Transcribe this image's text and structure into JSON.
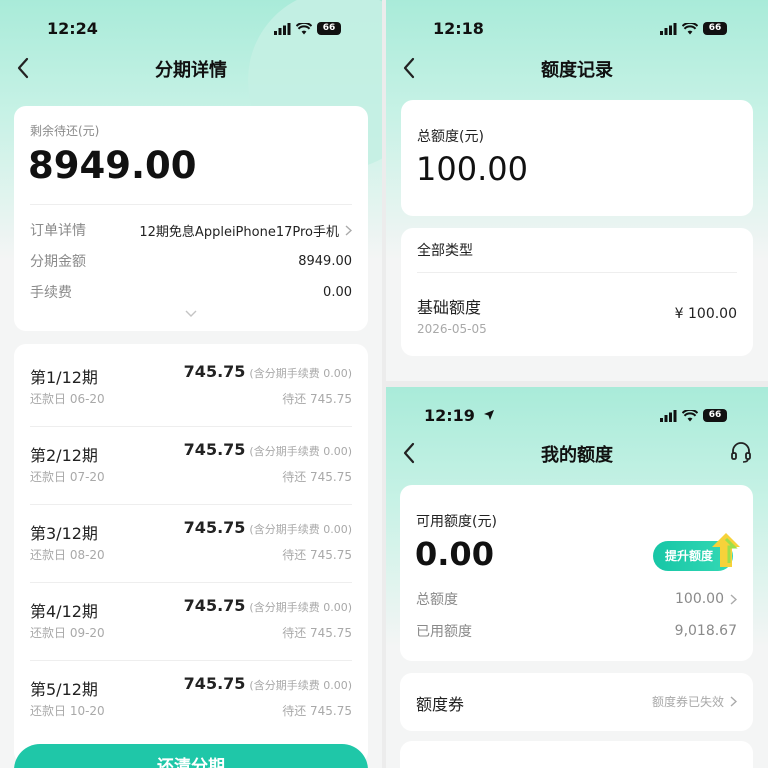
{
  "left": {
    "time": "12:24",
    "battery": "66",
    "title": "分期详情",
    "remaining_label": "剩余待还(元)",
    "remaining_amount": "8949.00",
    "order_label": "订单详情",
    "order_value": "12期免息AppleiPhone17Pro手机",
    "installment_label": "分期金额",
    "installment_value": "8949.00",
    "fee_label": "手续费",
    "fee_value": "0.00",
    "periods": [
      {
        "title": "第1/12期",
        "amount": "745.75",
        "fee_note": "(含分期手续费 0.00)",
        "due": "还款日 06-20",
        "pending": "待还 745.75"
      },
      {
        "title": "第2/12期",
        "amount": "745.75",
        "fee_note": "(含分期手续费 0.00)",
        "due": "还款日 07-20",
        "pending": "待还 745.75"
      },
      {
        "title": "第3/12期",
        "amount": "745.75",
        "fee_note": "(含分期手续费 0.00)",
        "due": "还款日 08-20",
        "pending": "待还 745.75"
      },
      {
        "title": "第4/12期",
        "amount": "745.75",
        "fee_note": "(含分期手续费 0.00)",
        "due": "还款日 09-20",
        "pending": "待还 745.75"
      },
      {
        "title": "第5/12期",
        "amount": "745.75",
        "fee_note": "(含分期手续费 0.00)",
        "due": "还款日 10-20",
        "pending": "待还 745.75"
      }
    ],
    "button_label": "还清分期"
  },
  "top_right": {
    "time": "12:18",
    "battery": "66",
    "title": "额度记录",
    "total_label": "总额度(元)",
    "total_value": "100.00",
    "filter_label": "全部类型",
    "record_name": "基础额度",
    "record_date": "2026-05-05",
    "record_amount": "¥ 100.00"
  },
  "bottom_right": {
    "time": "12:19",
    "battery": "66",
    "title": "我的额度",
    "available_label": "可用额度(元)",
    "available_value": "0.00",
    "raise_button": "提升额度",
    "total_label": "总额度",
    "total_value": "100.00",
    "used_label": "已用额度",
    "used_value": "9,018.67",
    "coupon_label": "额度券",
    "coupon_status": "额度券已失效"
  },
  "colors": {
    "accent": "#1fc7a8",
    "gradient_top": "#a9ebd9"
  }
}
